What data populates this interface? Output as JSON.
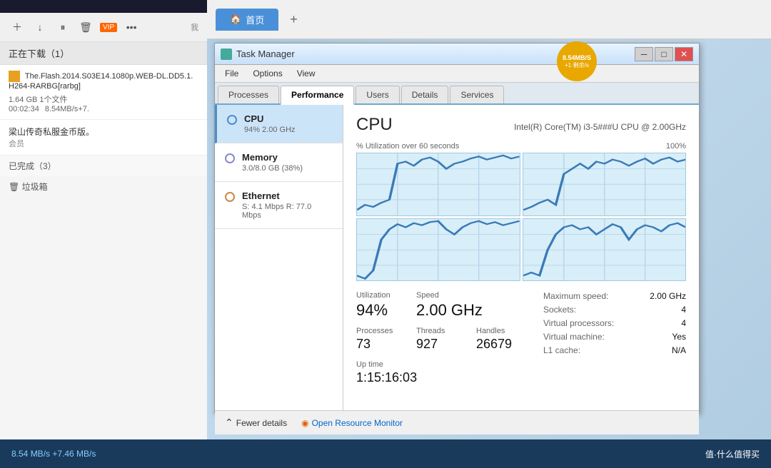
{
  "browser": {
    "tab_label": "首页",
    "tab_icon": "🏠",
    "new_tab_symbol": "+"
  },
  "download_manager": {
    "toolbar_buttons": [
      "+",
      "↓",
      "▐▐",
      "🗑",
      "VIP",
      "..."
    ],
    "header": "正在下载（1）",
    "item": {
      "name": "The.Flash.2014.S03E14.1080p.WEB-DL.DD5.1.H264-RARBG[rarbg]",
      "size": "1.64 GB  1个文件",
      "time": "00:02:34",
      "speed": "8.54MB/s+7."
    },
    "promo_text": "梁山传奇私服金币版。",
    "promo_badge": "会员",
    "completed_label": "已完成（3）",
    "trash_label": "垃圾箱"
  },
  "speed_badge": {
    "speed": "8.54MB/S",
    "delta": "+1·剩余/s"
  },
  "task_manager": {
    "title": "Task Manager",
    "menu": [
      "File",
      "Options",
      "View"
    ],
    "tabs": [
      "Processes",
      "Performance",
      "Users",
      "Details",
      "Services"
    ],
    "active_tab": "Performance",
    "resources": [
      {
        "name": "CPU",
        "detail": "94% 2.00 GHz",
        "type": "cpu",
        "active": true
      },
      {
        "name": "Memory",
        "detail": "3.0/8.0 GB (38%)",
        "type": "memory",
        "active": false
      },
      {
        "name": "Ethernet",
        "detail": "S: 4.1 Mbps  R: 77.0 Mbps",
        "type": "ethernet",
        "active": false
      }
    ],
    "cpu_panel": {
      "title": "CPU",
      "model": "Intel(R) Core(TM) i3-5###U CPU @ 2.00GHz",
      "graph_label": "% Utilization over 60 seconds",
      "graph_max": "100%",
      "stats": {
        "utilization_label": "Utilization",
        "utilization_value": "94%",
        "speed_label": "Speed",
        "speed_value": "2.00 GHz",
        "processes_label": "Processes",
        "processes_value": "73",
        "threads_label": "Threads",
        "threads_value": "927",
        "handles_label": "Handles",
        "handles_value": "26679",
        "uptime_label": "Up time",
        "uptime_value": "1:15:16:03"
      },
      "right_stats": {
        "maximum_speed_label": "Maximum speed:",
        "maximum_speed_value": "2.00 GHz",
        "sockets_label": "Sockets:",
        "sockets_value": "4",
        "virtual_processors_label": "Virtual processors:",
        "virtual_processors_value": "4",
        "virtual_machine_label": "Virtual machine:",
        "virtual_machine_value": "Yes",
        "l1_cache_label": "L1 cache:",
        "l1_cache_value": "N/A"
      }
    },
    "bottom": {
      "fewer_details_label": "Fewer details",
      "open_resource_label": "Open Resource Monitor"
    }
  },
  "screen_bottom": {
    "speed_label": "8.54 MB/s  +7.46 MB/s",
    "right_text": "值·什么值得买"
  }
}
